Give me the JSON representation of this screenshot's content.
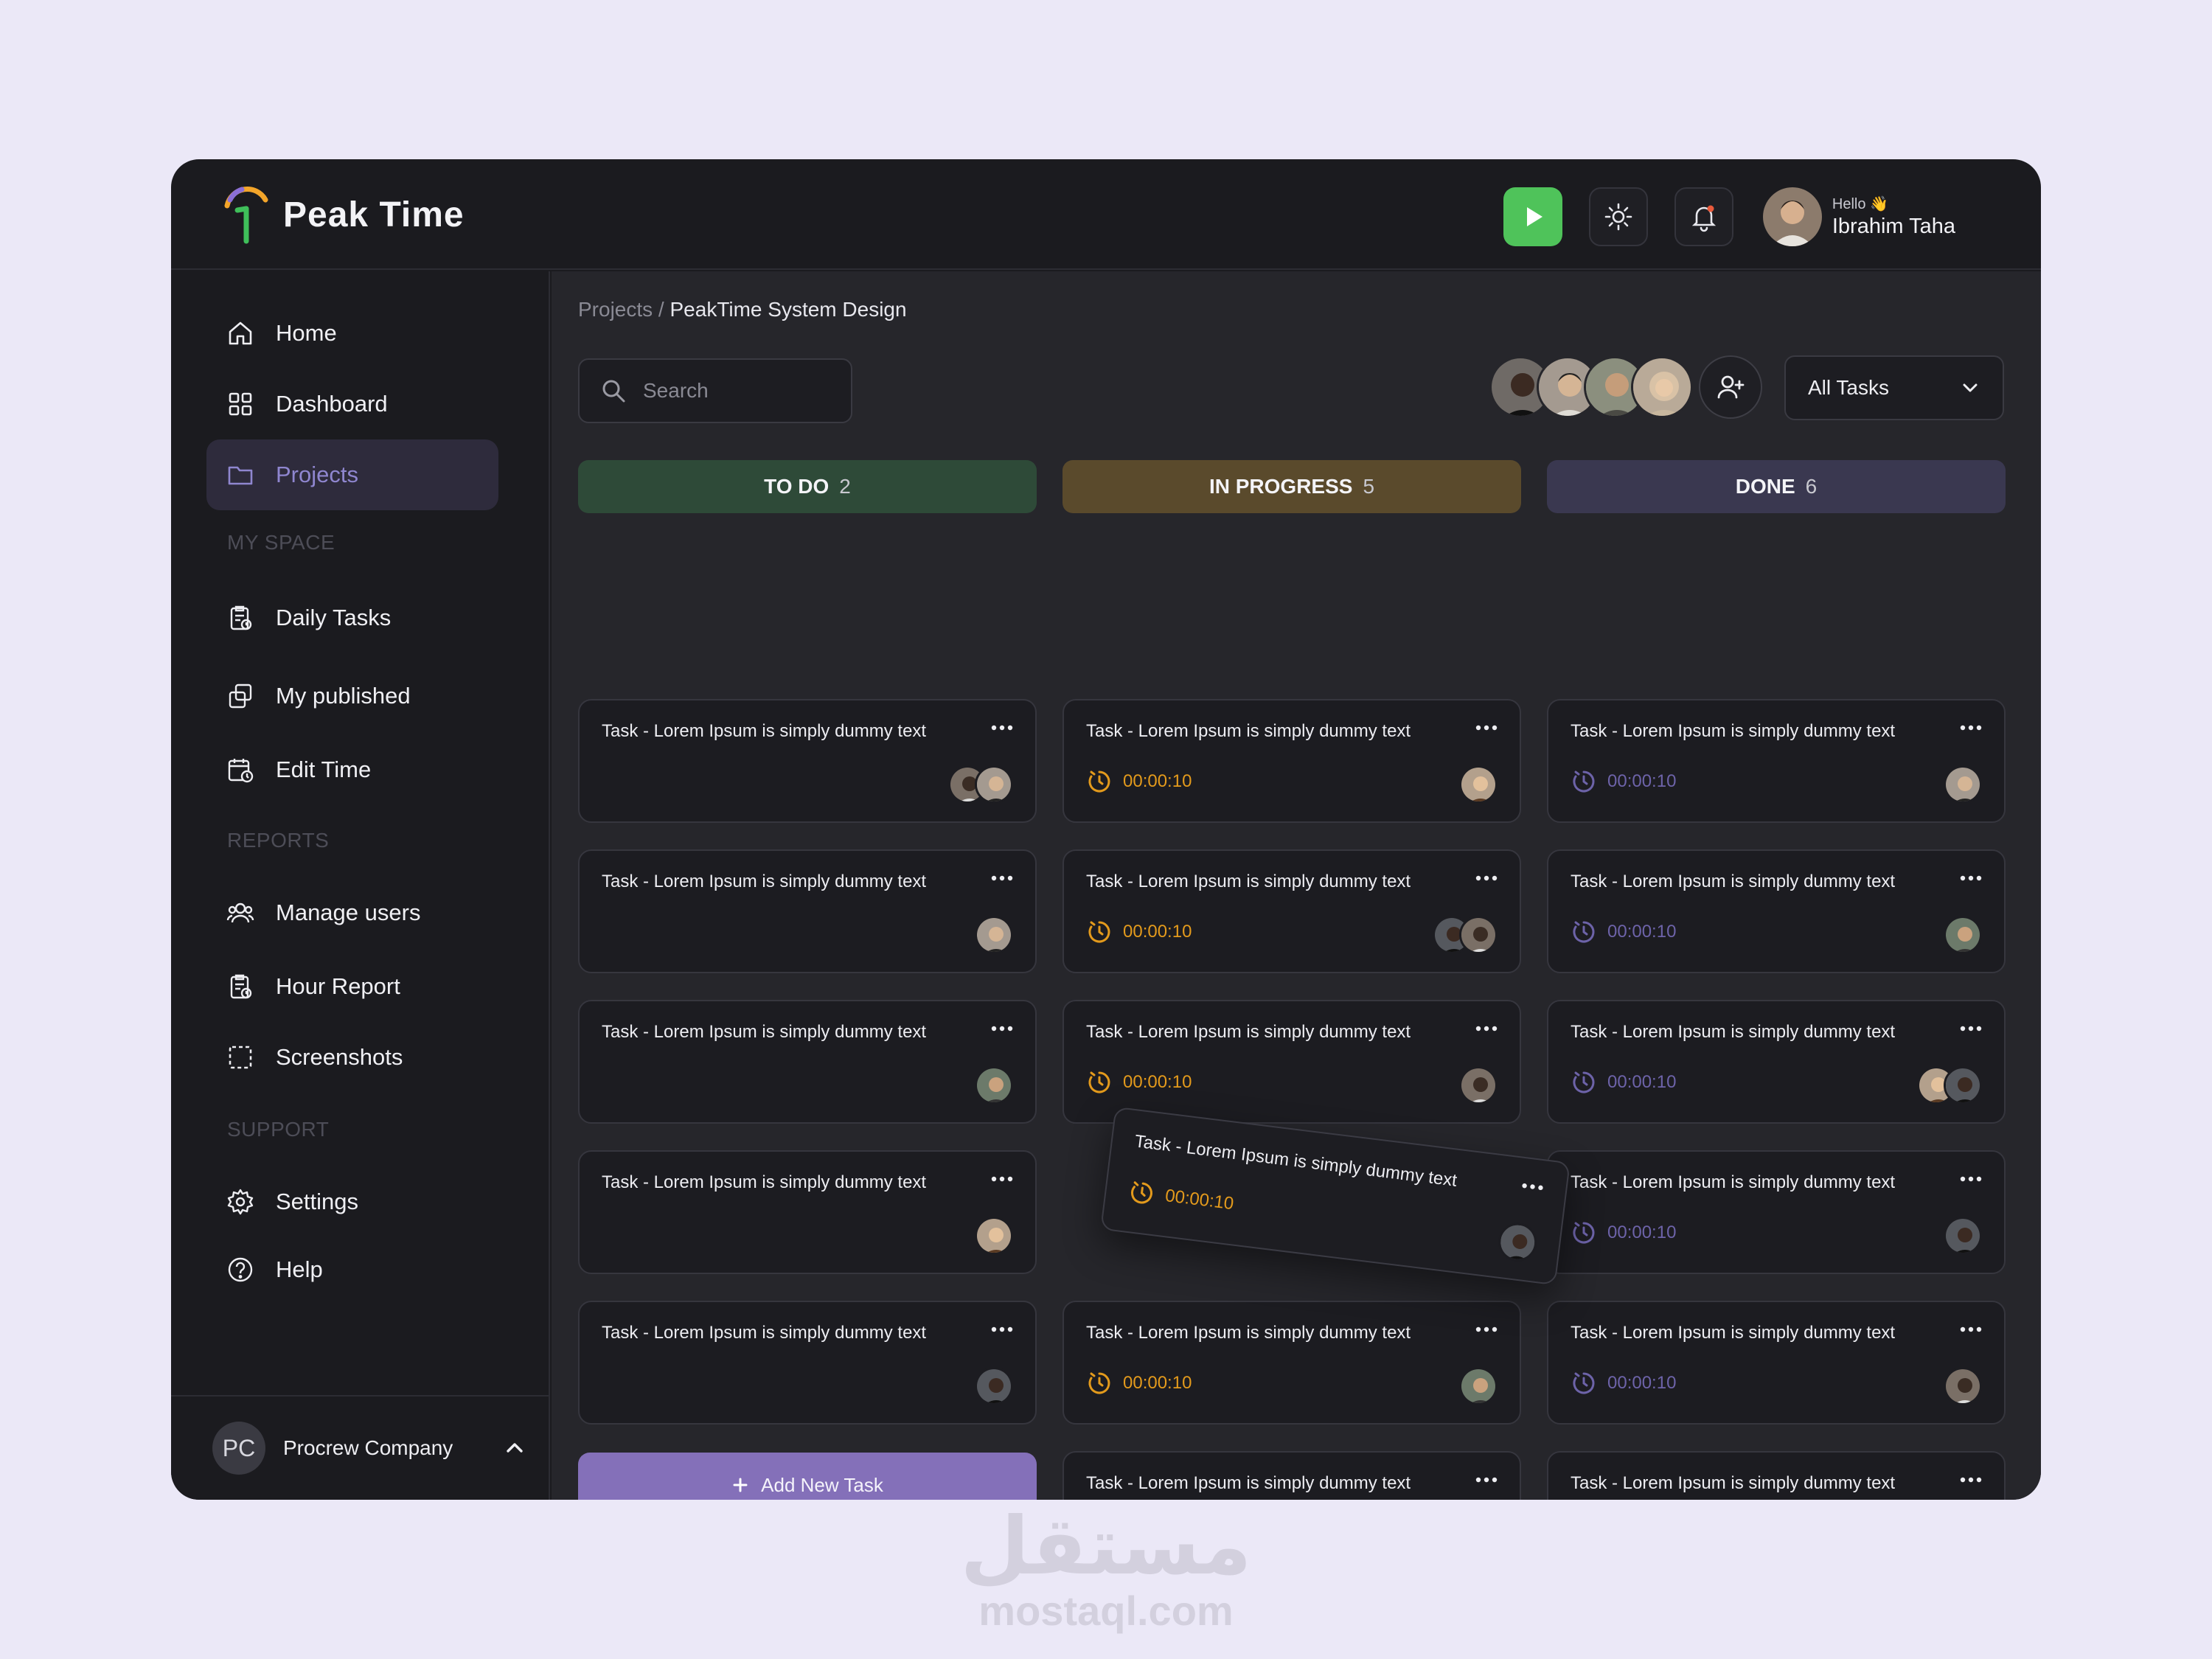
{
  "app": {
    "brand": "Peak Time"
  },
  "user": {
    "greeting": "Hello 👋",
    "name": "Ibrahim Taha"
  },
  "sidebar": {
    "items": [
      {
        "label": "Home",
        "icon": "home-icon"
      },
      {
        "label": "Dashboard",
        "icon": "grid-icon"
      },
      {
        "label": "Projects",
        "icon": "folder-icon",
        "active": true
      }
    ],
    "section_myspace": "MY SPACE",
    "myspace_items": [
      {
        "label": "Daily Tasks",
        "icon": "clipboard-icon"
      },
      {
        "label": "My published",
        "icon": "copy-icon"
      },
      {
        "label": "Edit Time",
        "icon": "calendar-clock-icon"
      }
    ],
    "section_reports": "REPORTS",
    "reports_items": [
      {
        "label": "Manage users",
        "icon": "users-icon"
      },
      {
        "label": "Hour Report",
        "icon": "report-icon"
      },
      {
        "label": "Screenshots",
        "icon": "screenshot-icon"
      }
    ],
    "section_support": "SUPPORT",
    "support_items": [
      {
        "label": "Settings",
        "icon": "gear-icon"
      },
      {
        "label": "Help",
        "icon": "help-icon"
      }
    ],
    "company": {
      "initials": "PC",
      "name": "Procrew Company"
    }
  },
  "breadcrumb": {
    "parent": "Projects",
    "separator": " / ",
    "current": "PeakTime System Design"
  },
  "search": {
    "placeholder": "Search"
  },
  "filter": {
    "value": "All Tasks"
  },
  "columns": [
    {
      "title": "TO DO",
      "count": "2",
      "color": "#2e4a38"
    },
    {
      "title": "IN PROGRESS",
      "count": "5",
      "color": "#5a4a2c"
    },
    {
      "title": "DONE",
      "count": "6",
      "color": "#3a3850"
    }
  ],
  "task_text": "Task - Lorem Ipsum is simply dummy text",
  "timer_text": "00:00:10",
  "add_task_label": "Add New Task",
  "colors": {
    "accent": "#8470b9",
    "progress": "#e39a1c",
    "done": "#6d63a9",
    "play": "#4fc35a"
  },
  "watermark": {
    "arabic": "مستقل",
    "latin": "mostaql.com"
  }
}
